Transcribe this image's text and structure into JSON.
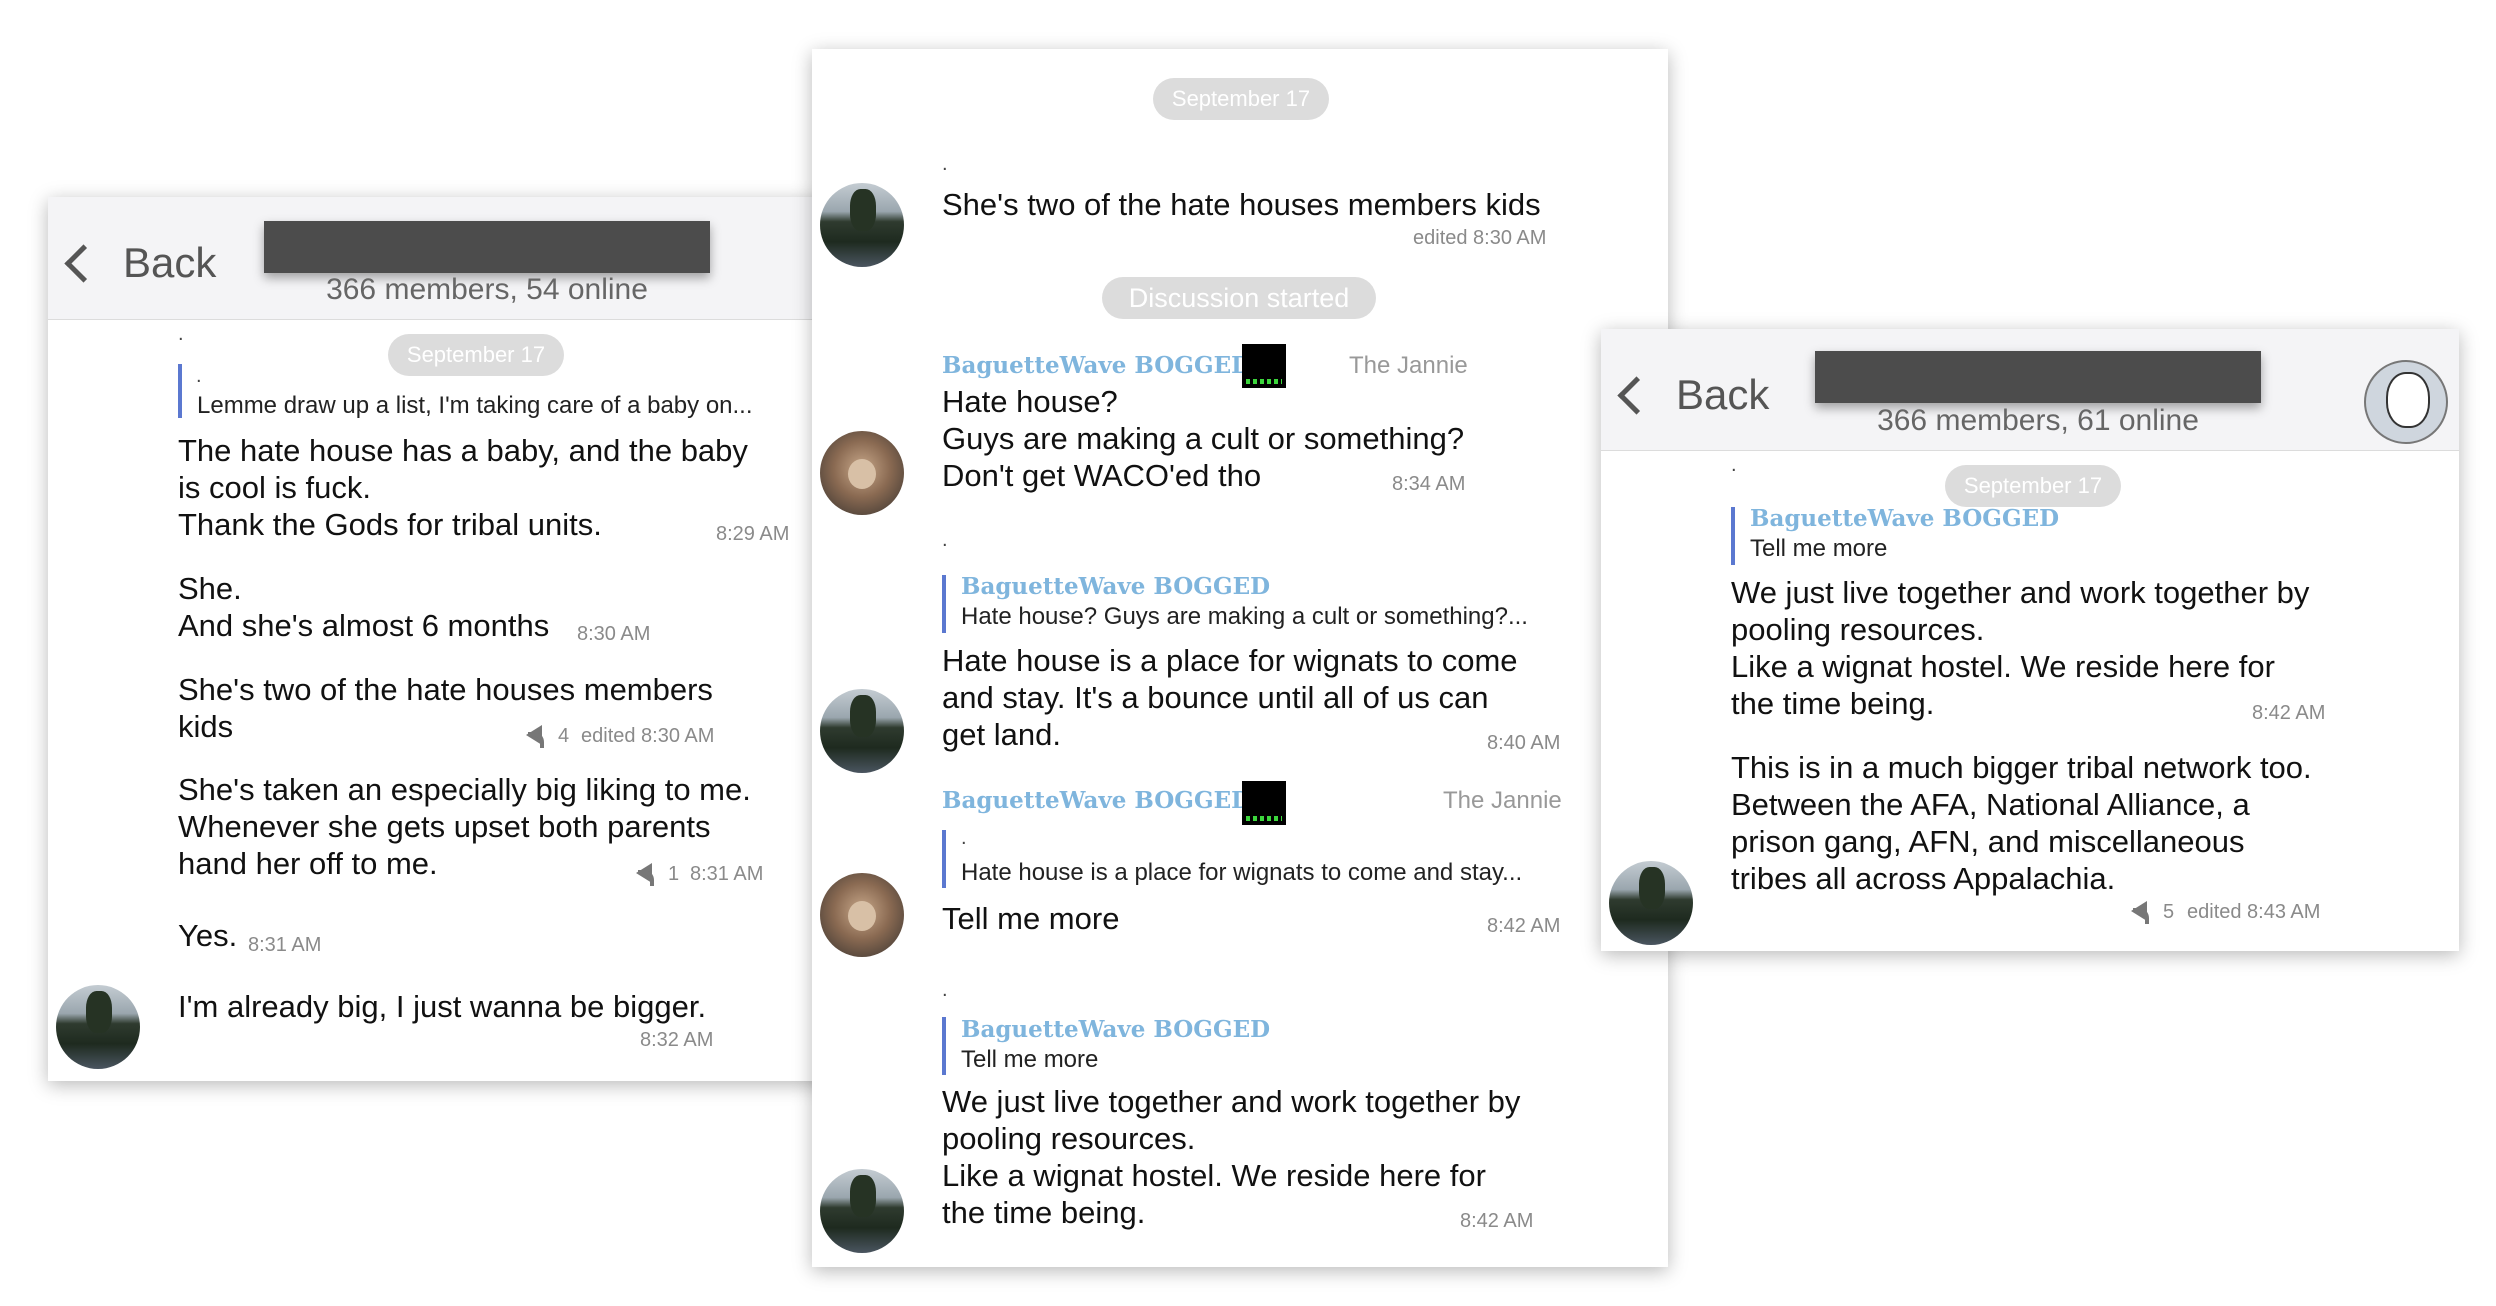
{
  "left": {
    "back_label": "Back",
    "members": "366 members, 54 online",
    "date_pill": "September 17",
    "dot": ".",
    "quote_dot": ".",
    "quote_text": "Lemme draw up a list, I'm taking care of a baby on...",
    "msg1_lines": [
      "The hate house has a baby, and the baby",
      "is cool is fuck.",
      "Thank the Gods for tribal units."
    ],
    "msg1_time": "8:29 AM",
    "msg2_lines": [
      "She.",
      "And she's almost 6 months"
    ],
    "msg2_time": "8:30 AM",
    "msg3_lines": [
      "She's two of the hate houses members",
      "kids"
    ],
    "msg3_replies": "4",
    "msg3_time": "edited 8:30 AM",
    "msg4_lines": [
      "She's taken an especially big liking to me.",
      "Whenever she gets upset both parents",
      "hand her off to me."
    ],
    "msg4_replies": "1",
    "msg4_time": "8:31 AM",
    "msg5_text": "Yes.",
    "msg5_time": "8:31 AM",
    "msg6_text": "I'm already big, I just wanna be bigger.",
    "msg6_time": "8:32 AM"
  },
  "middle": {
    "date_pill": "September 17",
    "dot1": ".",
    "msg1_text": "She's two of the hate houses members kids",
    "msg1_time": "edited 8:30 AM",
    "discussion_pill": "Discussion started",
    "msg2_sender": "BaguetteWave BOGGED",
    "msg2_role": "The Jannie",
    "msg2_lines": [
      "Hate house?",
      "Guys are making a cult or something?",
      "Don't get WACO'ed tho"
    ],
    "msg2_time": "8:34 AM",
    "dot2": ".",
    "msg3_quote_sender": "BaguetteWave BOGGED",
    "msg3_quote_text": "Hate house? Guys are making a cult or something?...",
    "msg3_lines": [
      "Hate house is a place for wignats to come",
      "and stay. It's a bounce until all of us can",
      "get land."
    ],
    "msg3_time": "8:40 AM",
    "msg4_sender": "BaguetteWave BOGGED",
    "msg4_role": "The Jannie",
    "msg4_quote_dot": ".",
    "msg4_quote_text": "Hate house is a place for wignats to come and stay...",
    "msg4_text": "Tell me more",
    "msg4_time": "8:42 AM",
    "dot3": ".",
    "msg5_quote_sender": "BaguetteWave BOGGED",
    "msg5_quote_text": "Tell me more",
    "msg5_lines": [
      "We just live together and work together by",
      "pooling resources.",
      "Like a wignat hostel. We reside here for",
      "the time being."
    ],
    "msg5_time": "8:42 AM"
  },
  "right": {
    "back_label": "Back",
    "members": "366 members, 61 online",
    "date_pill": "September 17",
    "dot": ".",
    "quote_sender": "BaguetteWave BOGGED",
    "quote_text": "Tell me more",
    "msg1_lines": [
      "We just live together and work together by",
      "pooling resources.",
      "Like a wignat hostel. We reside here for",
      "the time being."
    ],
    "msg1_time": "8:42 AM",
    "msg2_lines": [
      "This is in a much bigger tribal network too.",
      "Between the AFA, National Alliance, a",
      "prison gang, AFN, and miscellaneous",
      "tribes all across Appalachia."
    ],
    "msg2_replies": "5",
    "msg2_time": "edited 8:43 AM"
  }
}
